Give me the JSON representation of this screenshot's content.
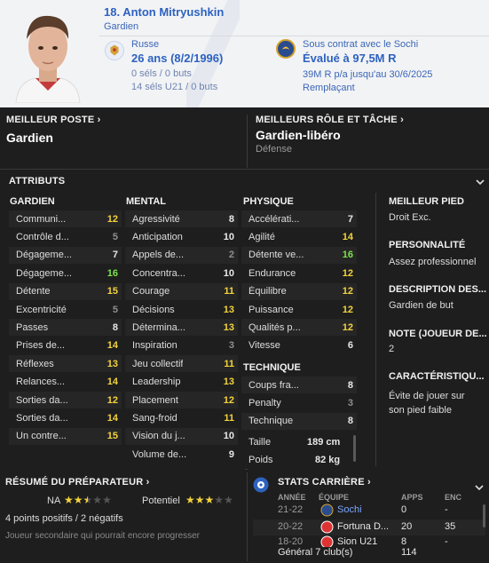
{
  "header": {
    "name": "18. Anton Mitryushkin",
    "position": "Gardien",
    "nationality": "Russe",
    "age": "26 ans (8/2/1996)",
    "caps": "0 séls / 0 buts",
    "u21_caps": "14 séls U21 / 0 buts",
    "contract": "Sous contrat avec le Sochi",
    "value": "Évalué à 97,5M R",
    "wage": "39M R p/a jusqu'au 30/6/2025",
    "squad_status": "Remplaçant"
  },
  "best_position": {
    "title": "MEILLEUR POSTE",
    "value": "Gardien"
  },
  "best_role": {
    "title": "MEILLEURS RÔLE ET TÂCHE",
    "value": "Gardien-libéro",
    "duty": "Défense"
  },
  "attributes": {
    "title": "ATTRIBUTS",
    "goalkeeper": {
      "title": "GARDIEN",
      "items": [
        {
          "label": "Communi...",
          "value": "12"
        },
        {
          "label": "Contrôle d...",
          "value": "5"
        },
        {
          "label": "Dégageme...",
          "value": "7"
        },
        {
          "label": "Dégageme...",
          "value": "16"
        },
        {
          "label": "Détente",
          "value": "15"
        },
        {
          "label": "Excentricité",
          "value": "5"
        },
        {
          "label": "Passes",
          "value": "8"
        },
        {
          "label": "Prises de...",
          "value": "14"
        },
        {
          "label": "Réflexes",
          "value": "13"
        },
        {
          "label": "Relances...",
          "value": "14"
        },
        {
          "label": "Sorties da...",
          "value": "12"
        },
        {
          "label": "Sorties da...",
          "value": "14"
        },
        {
          "label": "Un contre...",
          "value": "15"
        }
      ]
    },
    "mental": {
      "title": "MENTAL",
      "items": [
        {
          "label": "Agressivité",
          "value": "8"
        },
        {
          "label": "Anticipation",
          "value": "10"
        },
        {
          "label": "Appels de...",
          "value": "2"
        },
        {
          "label": "Concentra...",
          "value": "10"
        },
        {
          "label": "Courage",
          "value": "11"
        },
        {
          "label": "Décisions",
          "value": "13"
        },
        {
          "label": "Détermina...",
          "value": "13"
        },
        {
          "label": "Inspiration",
          "value": "3"
        },
        {
          "label": "Jeu collectif",
          "value": "11"
        },
        {
          "label": "Leadership",
          "value": "13"
        },
        {
          "label": "Placement",
          "value": "12"
        },
        {
          "label": "Sang-froid",
          "value": "11"
        },
        {
          "label": "Vision du j...",
          "value": "10"
        },
        {
          "label": "Volume de...",
          "value": "9"
        }
      ]
    },
    "physical": {
      "title": "PHYSIQUE",
      "items": [
        {
          "label": "Accélérati...",
          "value": "7"
        },
        {
          "label": "Agilité",
          "value": "14"
        },
        {
          "label": "Détente ve...",
          "value": "16"
        },
        {
          "label": "Endurance",
          "value": "12"
        },
        {
          "label": "Équilibre",
          "value": "12"
        },
        {
          "label": "Puissance",
          "value": "12"
        },
        {
          "label": "Qualités p...",
          "value": "12"
        },
        {
          "label": "Vitesse",
          "value": "6"
        }
      ]
    },
    "technical": {
      "title": "TECHNIQUE",
      "items": [
        {
          "label": "Coups fra...",
          "value": "8"
        },
        {
          "label": "Penalty",
          "value": "3"
        },
        {
          "label": "Technique",
          "value": "8"
        }
      ]
    },
    "height_label": "Taille",
    "height": "189 cm",
    "weight_label": "Poids",
    "weight": "82 kg"
  },
  "side_info": {
    "best_foot_title": "MEILLEUR PIED",
    "best_foot": "Droit Exc.",
    "personality_title": "PERSONNALITÉ",
    "personality": "Assez professionnel",
    "description_title": "DESCRIPTION DES...",
    "description": "Gardien de but",
    "rating_title": "NOTE (JOUEUR DE...",
    "rating": "2",
    "traits_title": "CARACTÉRISTIQU...",
    "traits_line1": "Évite de jouer sur",
    "traits_line2": "son pied faible"
  },
  "coach_report": {
    "title": "RÉSUMÉ DU PRÉPARATEUR",
    "current_label": "NA",
    "current_stars": 2.5,
    "potential_label": "Potentiel",
    "potential_stars": 3,
    "summary": "4 points positifs / 2 négatifs",
    "note": "Joueur secondaire qui pourrait encore progresser"
  },
  "career": {
    "title": "STATS CARRIÈRE",
    "headers": {
      "year": "ANNÉE",
      "team": "ÉQUIPE",
      "apps": "APPS",
      "goals": "ENC"
    },
    "rows": [
      {
        "year": "21-22",
        "team": "Sochi",
        "apps": "0",
        "goals": "-"
      },
      {
        "year": "20-22",
        "team": "Fortuna D...",
        "apps": "20",
        "goals": "35"
      },
      {
        "year": "18-20",
        "team": "Sion U21",
        "apps": "8",
        "goals": "-"
      }
    ],
    "total_label": "Général 7 club(s)",
    "total_apps": "114"
  },
  "colors": {
    "yellow": "#f3d33c",
    "green": "#7ee24a",
    "grey": "#8f8f8f",
    "accent": "#2d62c0"
  }
}
